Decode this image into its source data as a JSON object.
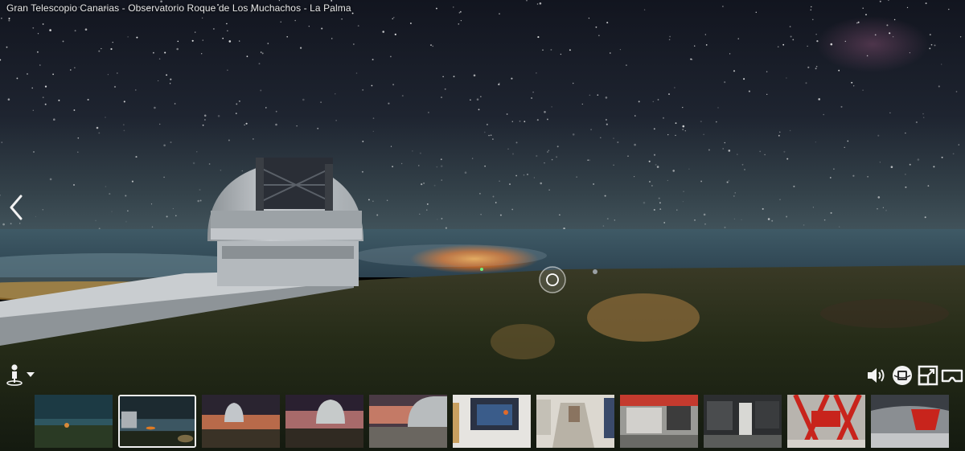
{
  "tour": {
    "title": "Gran Telescopio Canarias - Observatorio Roque de Los Muchachos - La Palma"
  },
  "controls": {
    "prev_icon": "chevron-left-icon",
    "person_icon": "person-icon",
    "sound_icon": "volume-icon",
    "gyro_icon": "gyroscope-icon",
    "fullscreen_icon": "fullscreen-icon",
    "vr_icon": "vr-headset-icon"
  },
  "colors": {
    "sky_top": "#161a26",
    "sky_horizon": "#3a4e56",
    "sea_cloud": "#4e6878",
    "glow": "#ff8a1e",
    "ground": "#262c1a",
    "dome": "#b8bcc0"
  },
  "thumbnails": {
    "active_index": 1,
    "count": 11,
    "scenes": [
      "night-sky-aurora",
      "night-horizon-active",
      "dome-milkyway-1",
      "dome-milkyway-2",
      "dome-dusk",
      "exhibit-screen",
      "corridor",
      "control-room",
      "dark-room",
      "telescope-red-structure",
      "dome-interior"
    ]
  }
}
